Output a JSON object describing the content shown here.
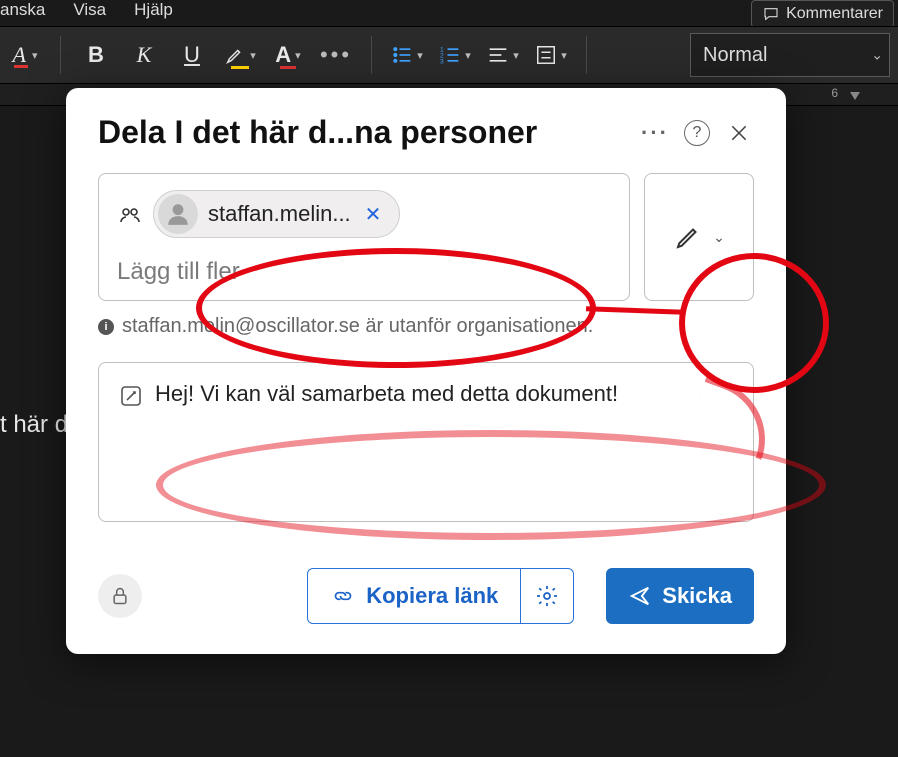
{
  "menubar": {
    "items": [
      "anska",
      "Visa",
      "Hjälp"
    ],
    "comments_label": "Kommentarer"
  },
  "ribbon": {
    "style_picker": "Normal"
  },
  "ruler": {
    "tick": "6"
  },
  "document": {
    "background_text_fragment": "t här d"
  },
  "dialog": {
    "title": "Dela I det här d...na personer",
    "recipient_chip": "staffan.melin...",
    "add_more_placeholder": "Lägg till fler",
    "warning": "staffan.melin@oscillator.se är utanför organisationen.",
    "message": "Hej! Vi kan väl samarbeta med detta dokument!",
    "copy_link_label": "Kopiera länk",
    "send_label": "Skicka"
  }
}
